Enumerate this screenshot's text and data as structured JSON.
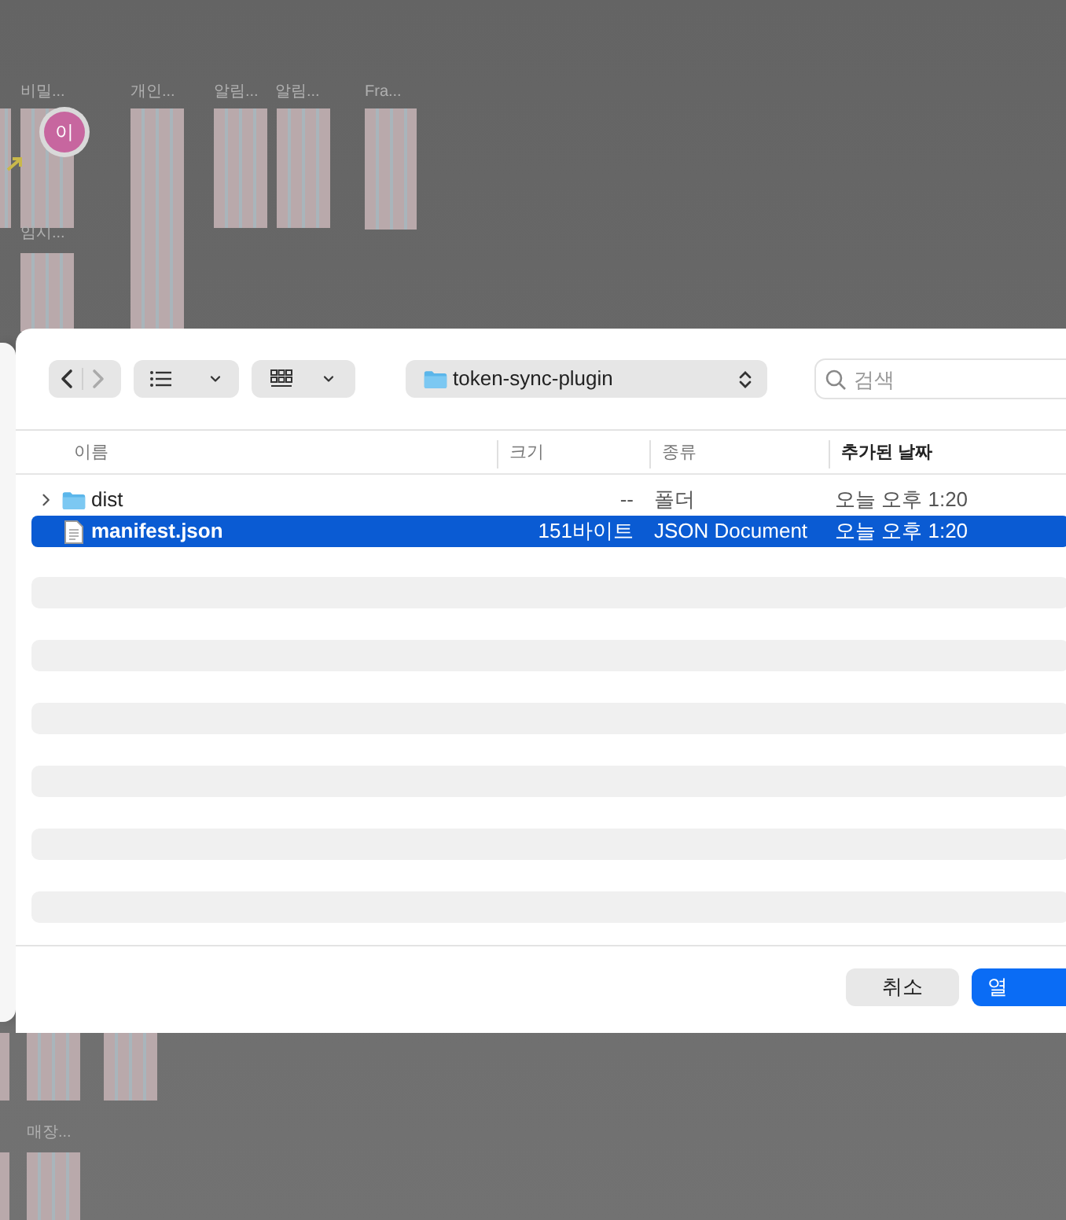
{
  "canvas": {
    "frames": [
      {
        "label": "비밀..."
      },
      {
        "label": "개인..."
      },
      {
        "label": "알림..."
      },
      {
        "label": "알림..."
      },
      {
        "label": "Fra..."
      },
      {
        "label": "임시..."
      },
      {
        "label": "매장..."
      }
    ],
    "avatar": {
      "initial": "이"
    }
  },
  "dialog": {
    "location": "token-sync-plugin",
    "search": {
      "placeholder": "검색"
    },
    "columns": [
      {
        "label": "이름",
        "selected": false
      },
      {
        "label": "크기",
        "selected": false
      },
      {
        "label": "종류",
        "selected": false
      },
      {
        "label": "추가된 날짜",
        "selected": true
      }
    ],
    "rows": [
      {
        "kind": "folder",
        "name": "dist",
        "size": "--",
        "type": "폴더",
        "date": "오늘 오후 1:20",
        "selected": false,
        "expanded": false
      },
      {
        "kind": "file",
        "name": "manifest.json",
        "size": "151바이트",
        "type": "JSON Document",
        "date": "오늘 오후 1:20",
        "selected": true
      }
    ],
    "buttons": [
      {
        "label": "취소",
        "kind": "secondary"
      },
      {
        "label": "열",
        "kind": "primary"
      }
    ]
  }
}
